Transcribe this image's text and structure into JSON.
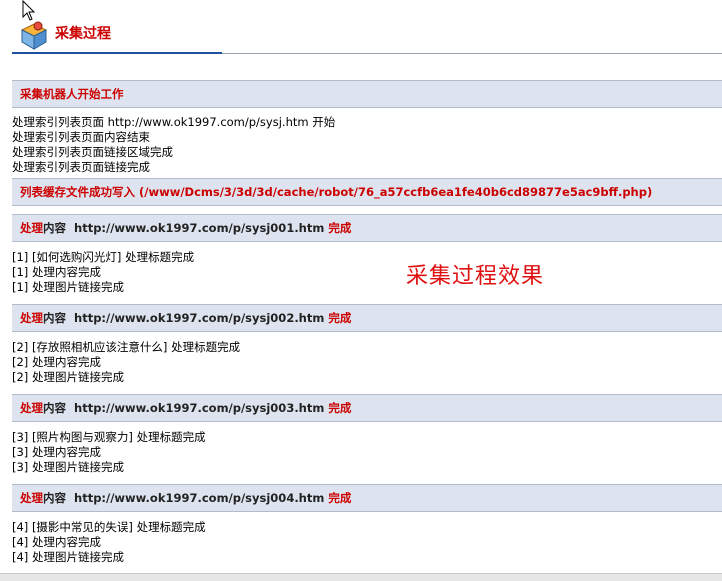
{
  "header": {
    "title": "采集过程",
    "logo_icon": "box-robot-icon"
  },
  "sections": {
    "start": {
      "bar_label": "采集机器人开始工作",
      "lines": [
        "处理索引列表页面  http://www.ok1997.com/p/sysj.htm 开始",
        "处理索引列表页面内容结束",
        "处理索引列表页面链接区域完成",
        "处理索引列表页面链接完成"
      ]
    },
    "cache": {
      "bar_label": "列表缓存文件成功写入  (/www/Dcms/3/3d/3d/cache/robot/76_a57ccfb6ea1fe40b6cd89877e5ac9bff.php)"
    },
    "items": [
      {
        "prefix": "处理",
        "mid": "内容  http://www.ok1997.com/p/sysj001.htm ",
        "suffix": "完成",
        "lines": [
          "[1] [如何选购闪光灯] 处理标题完成",
          "[1] 处理内容完成",
          "[1] 处理图片链接完成"
        ]
      },
      {
        "prefix": "处理",
        "mid": "内容  http://www.ok1997.com/p/sysj002.htm ",
        "suffix": "完成",
        "lines": [
          "[2] [存放照相机应该注意什么] 处理标题完成",
          "[2] 处理内容完成",
          "[2] 处理图片链接完成"
        ]
      },
      {
        "prefix": "处理",
        "mid": "内容  http://www.ok1997.com/p/sysj003.htm ",
        "suffix": "完成",
        "lines": [
          "[3] [照片构图与观察力] 处理标题完成",
          "[3] 处理内容完成",
          "[3] 处理图片链接完成"
        ]
      },
      {
        "prefix": "处理",
        "mid": "内容  http://www.ok1997.com/p/sysj004.htm ",
        "suffix": "完成",
        "lines": [
          "[4] [摄影中常见的失误] 处理标题完成",
          "[4] 处理内容完成",
          "[4] 处理图片链接完成"
        ]
      }
    ]
  },
  "overlay_text": "采集过程效果"
}
